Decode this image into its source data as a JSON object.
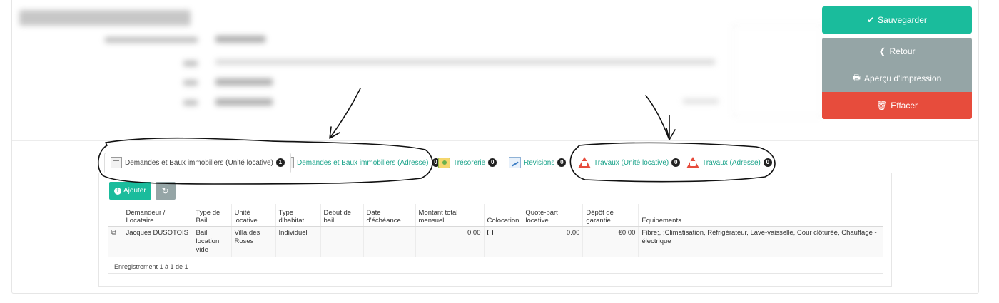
{
  "actions": {
    "save": "Sauvegarder",
    "back": "Retour",
    "print": "Aperçu d'impression",
    "delete": "Effacer"
  },
  "tabs": [
    {
      "label": "Demandes et Baux immobiliers (Unité locative)",
      "count": "1",
      "icon": "document-icon",
      "active": true
    },
    {
      "label": "Demandes et Baux immobiliers (Adresse)",
      "count": "0",
      "icon": "document-icon",
      "active": false
    },
    {
      "label": "Trésorerie",
      "count": "0",
      "icon": "treasury-icon",
      "active": false
    },
    {
      "label": "Revisions",
      "count": "0",
      "icon": "revision-chart-icon",
      "active": false
    },
    {
      "label": "Travaux (Unité locative)",
      "count": "0",
      "icon": "roadwork-warning-icon",
      "active": false
    },
    {
      "label": "Travaux (Adresse)",
      "count": "0",
      "icon": "roadwork-warning-icon",
      "active": false
    }
  ],
  "toolbar": {
    "add": "Ajouter",
    "refresh_icon": "refresh-icon"
  },
  "table": {
    "columns": [
      "Demandeur / Locataire",
      "Type de Bail",
      "Unité locative",
      "Type d'habitat",
      "Debut de bail",
      "Date d'échéance",
      "Montant total mensuel",
      "Colocation",
      "Quote-part locative",
      "Dépôt de garantie",
      "Équipements"
    ],
    "rows": [
      {
        "tenant": "Jacques DUSOTOIS",
        "lease_type": "Bail location vide",
        "unit": "Villa des Roses",
        "habitat": "Individuel",
        "start": "",
        "end": "",
        "monthly_total": "0.00",
        "colocation": false,
        "share": "0.00",
        "deposit": "€0.00",
        "equipment": "Fibre;, ;Climatisation, Réfrigérateur, Lave-vaisselle, Cour clôturée, Chauffage - électrique"
      }
    ],
    "footer": "Enregistrement 1 à 1 de 1"
  },
  "colors": {
    "accent": "#1abc9c",
    "secondary": "#95a5a6",
    "danger": "#e74c3c",
    "badge": "#222222"
  }
}
